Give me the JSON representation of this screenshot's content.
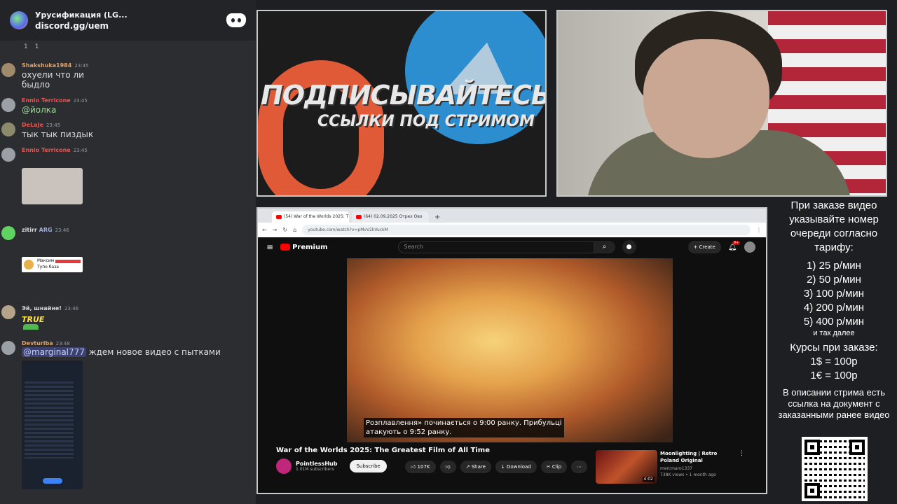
{
  "discord": {
    "server_title": "Урусификация (LG...",
    "server_link": "discord.gg/uem",
    "reactions": [
      "1",
      "1"
    ],
    "messages": [
      {
        "user": "Shakshuka1984",
        "time": "23:45",
        "color": "#e0a36b",
        "text": "охуели что ли\nбыдло"
      },
      {
        "user": "Ennio Terricone",
        "time": "23:45",
        "color": "#e8554e",
        "mention": "@йолка"
      },
      {
        "user": "DeLaJe",
        "time": "23:45",
        "color": "#e8554e",
        "text": "тык тык пиздык"
      },
      {
        "user": "Ennio Terricone",
        "time": "23:45",
        "color": "#e8554e"
      },
      {
        "user": "zitirr",
        "badge": "ARG",
        "time": "23:46",
        "color": "#d8d8d8"
      },
      {
        "card_name": "Максим",
        "card_text": "Тупо база"
      },
      {
        "user": "Эй, шнайне!",
        "time": "23:46",
        "color": "#d8d8d8",
        "sticker": "TRUE"
      },
      {
        "user": "Devturiba",
        "time": "23:48",
        "color": "#e0a36b",
        "mention": "@marginal777",
        "text": " ждем новое видео с пытками"
      }
    ]
  },
  "banner": {
    "line1": "ПОДПИСЫВАЙТЕСЬ",
    "line2": "ССЫЛКИ ПОД СТРИМОМ"
  },
  "browser": {
    "tabs": [
      "(54) War of the Worlds 2025: T",
      "(64) 02.09.2025 Отрех Ово"
    ],
    "url": "youtube.com/watch?v=pMvV2kVuckM",
    "search_placeholder": "Search",
    "logo": "Premium",
    "create_label": "Create",
    "notif_badge": "9+",
    "subtitles": "Розплавлення» починається о 9:00 ранку. Прибульці\nатакують о 9:52 ранку.",
    "video_title": "War of the Worlds 2025: The Greatest Film of All Time",
    "channel": "PointlessHub",
    "subscribers": "1.01M subscribers",
    "subscribe_label": "Subscribe",
    "likes": "107K",
    "share_label": "Share",
    "download_label": "Download",
    "clip_label": "Clip",
    "rec": {
      "title": "Moonlighting | Retro Poland Original",
      "channel": "mercmaro1337",
      "meta": "738K views • 1 month ago",
      "duration": "4:02"
    }
  },
  "info": {
    "intro": "При заказе видео указывайте номер очереди согласно тарифу:",
    "tariffs": [
      "1) 25 р/мин",
      "2) 50 р/мин",
      "3) 100 р/мин",
      "4) 200 р/мин",
      "5) 400 р/мин"
    ],
    "etc": "и так далее",
    "rates_title": "Курсы при заказе:",
    "rate1": "1$ = 100р",
    "rate2": "1€ = 100р",
    "footer": "В описании стрима есть ссылка на документ с заказанными ранее видео"
  }
}
